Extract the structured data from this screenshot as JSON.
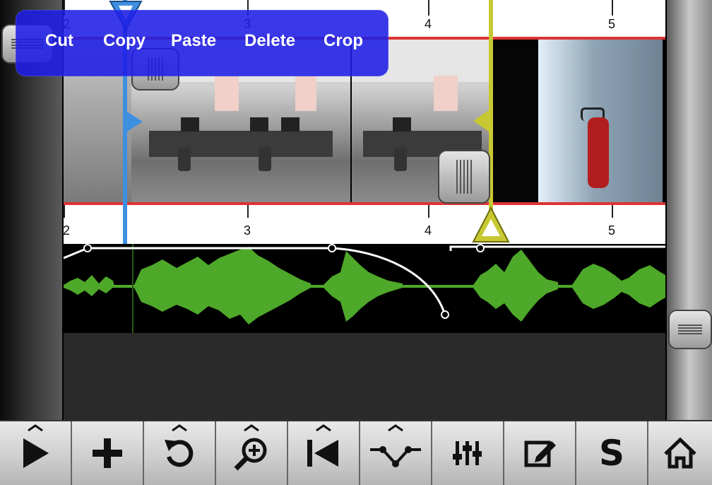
{
  "edit_menu": {
    "items": [
      {
        "label": "Cut"
      },
      {
        "label": "Copy"
      },
      {
        "label": "Paste"
      },
      {
        "label": "Delete"
      },
      {
        "label": "Crop"
      }
    ]
  },
  "ruler": {
    "labels": [
      "2",
      "3",
      "4",
      "5"
    ]
  },
  "toolbar": {
    "items": [
      {
        "name": "play",
        "icon": "play-icon"
      },
      {
        "name": "add",
        "icon": "plus-icon"
      },
      {
        "name": "undo",
        "icon": "undo-icon"
      },
      {
        "name": "zoom",
        "icon": "zoom-in-icon"
      },
      {
        "name": "rewind",
        "icon": "skip-to-start-icon"
      },
      {
        "name": "envelope",
        "icon": "envelope-node-icon"
      },
      {
        "name": "mixer",
        "icon": "mixer-sliders-icon"
      },
      {
        "name": "edit",
        "icon": "edit-pencil-icon"
      },
      {
        "name": "solo",
        "label": "S"
      },
      {
        "name": "home",
        "icon": "home-icon"
      }
    ]
  },
  "colors": {
    "selection_handle": "#3f8fe0",
    "playhead": "#c8c832",
    "waveform": "#4ea82a",
    "menu_bg": "#1e1ee6",
    "track_border": "#dd3333"
  }
}
